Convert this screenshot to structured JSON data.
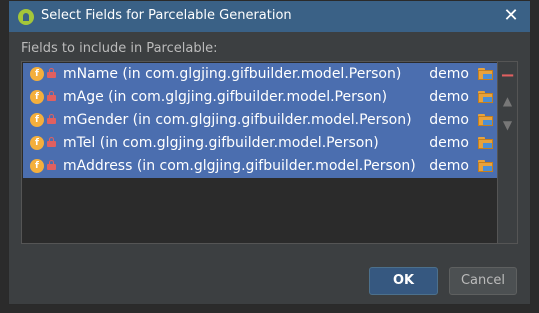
{
  "window": {
    "title": "Select Fields for Parcelable Generation",
    "close_glyph": "✕"
  },
  "section_label": "Fields to include in Parcelable:",
  "fields": [
    {
      "name": "mName (in com.glgjing.gifbuilder.model.Person)",
      "module": "demo"
    },
    {
      "name": "mAge (in com.glgjing.gifbuilder.model.Person)",
      "module": "demo"
    },
    {
      "name": "mGender (in com.glgjing.gifbuilder.model.Person)",
      "module": "demo"
    },
    {
      "name": "mTel (in com.glgjing.gifbuilder.model.Person)",
      "module": "demo"
    },
    {
      "name": "mAddress (in com.glgjing.gifbuilder.model.Person)",
      "module": "demo"
    }
  ],
  "field_icon_letter": "f",
  "toolbar": {
    "remove_glyph": "−",
    "up_glyph": "▲",
    "down_glyph": "▼"
  },
  "buttons": {
    "ok_label": "OK",
    "cancel_label": "Cancel"
  },
  "colors": {
    "title_bar": "#3a6186",
    "selection": "#4b6eaf",
    "dialog_bg": "#3c3f41",
    "field_icon": "#f4af3d",
    "lock_icon": "#e06060"
  }
}
